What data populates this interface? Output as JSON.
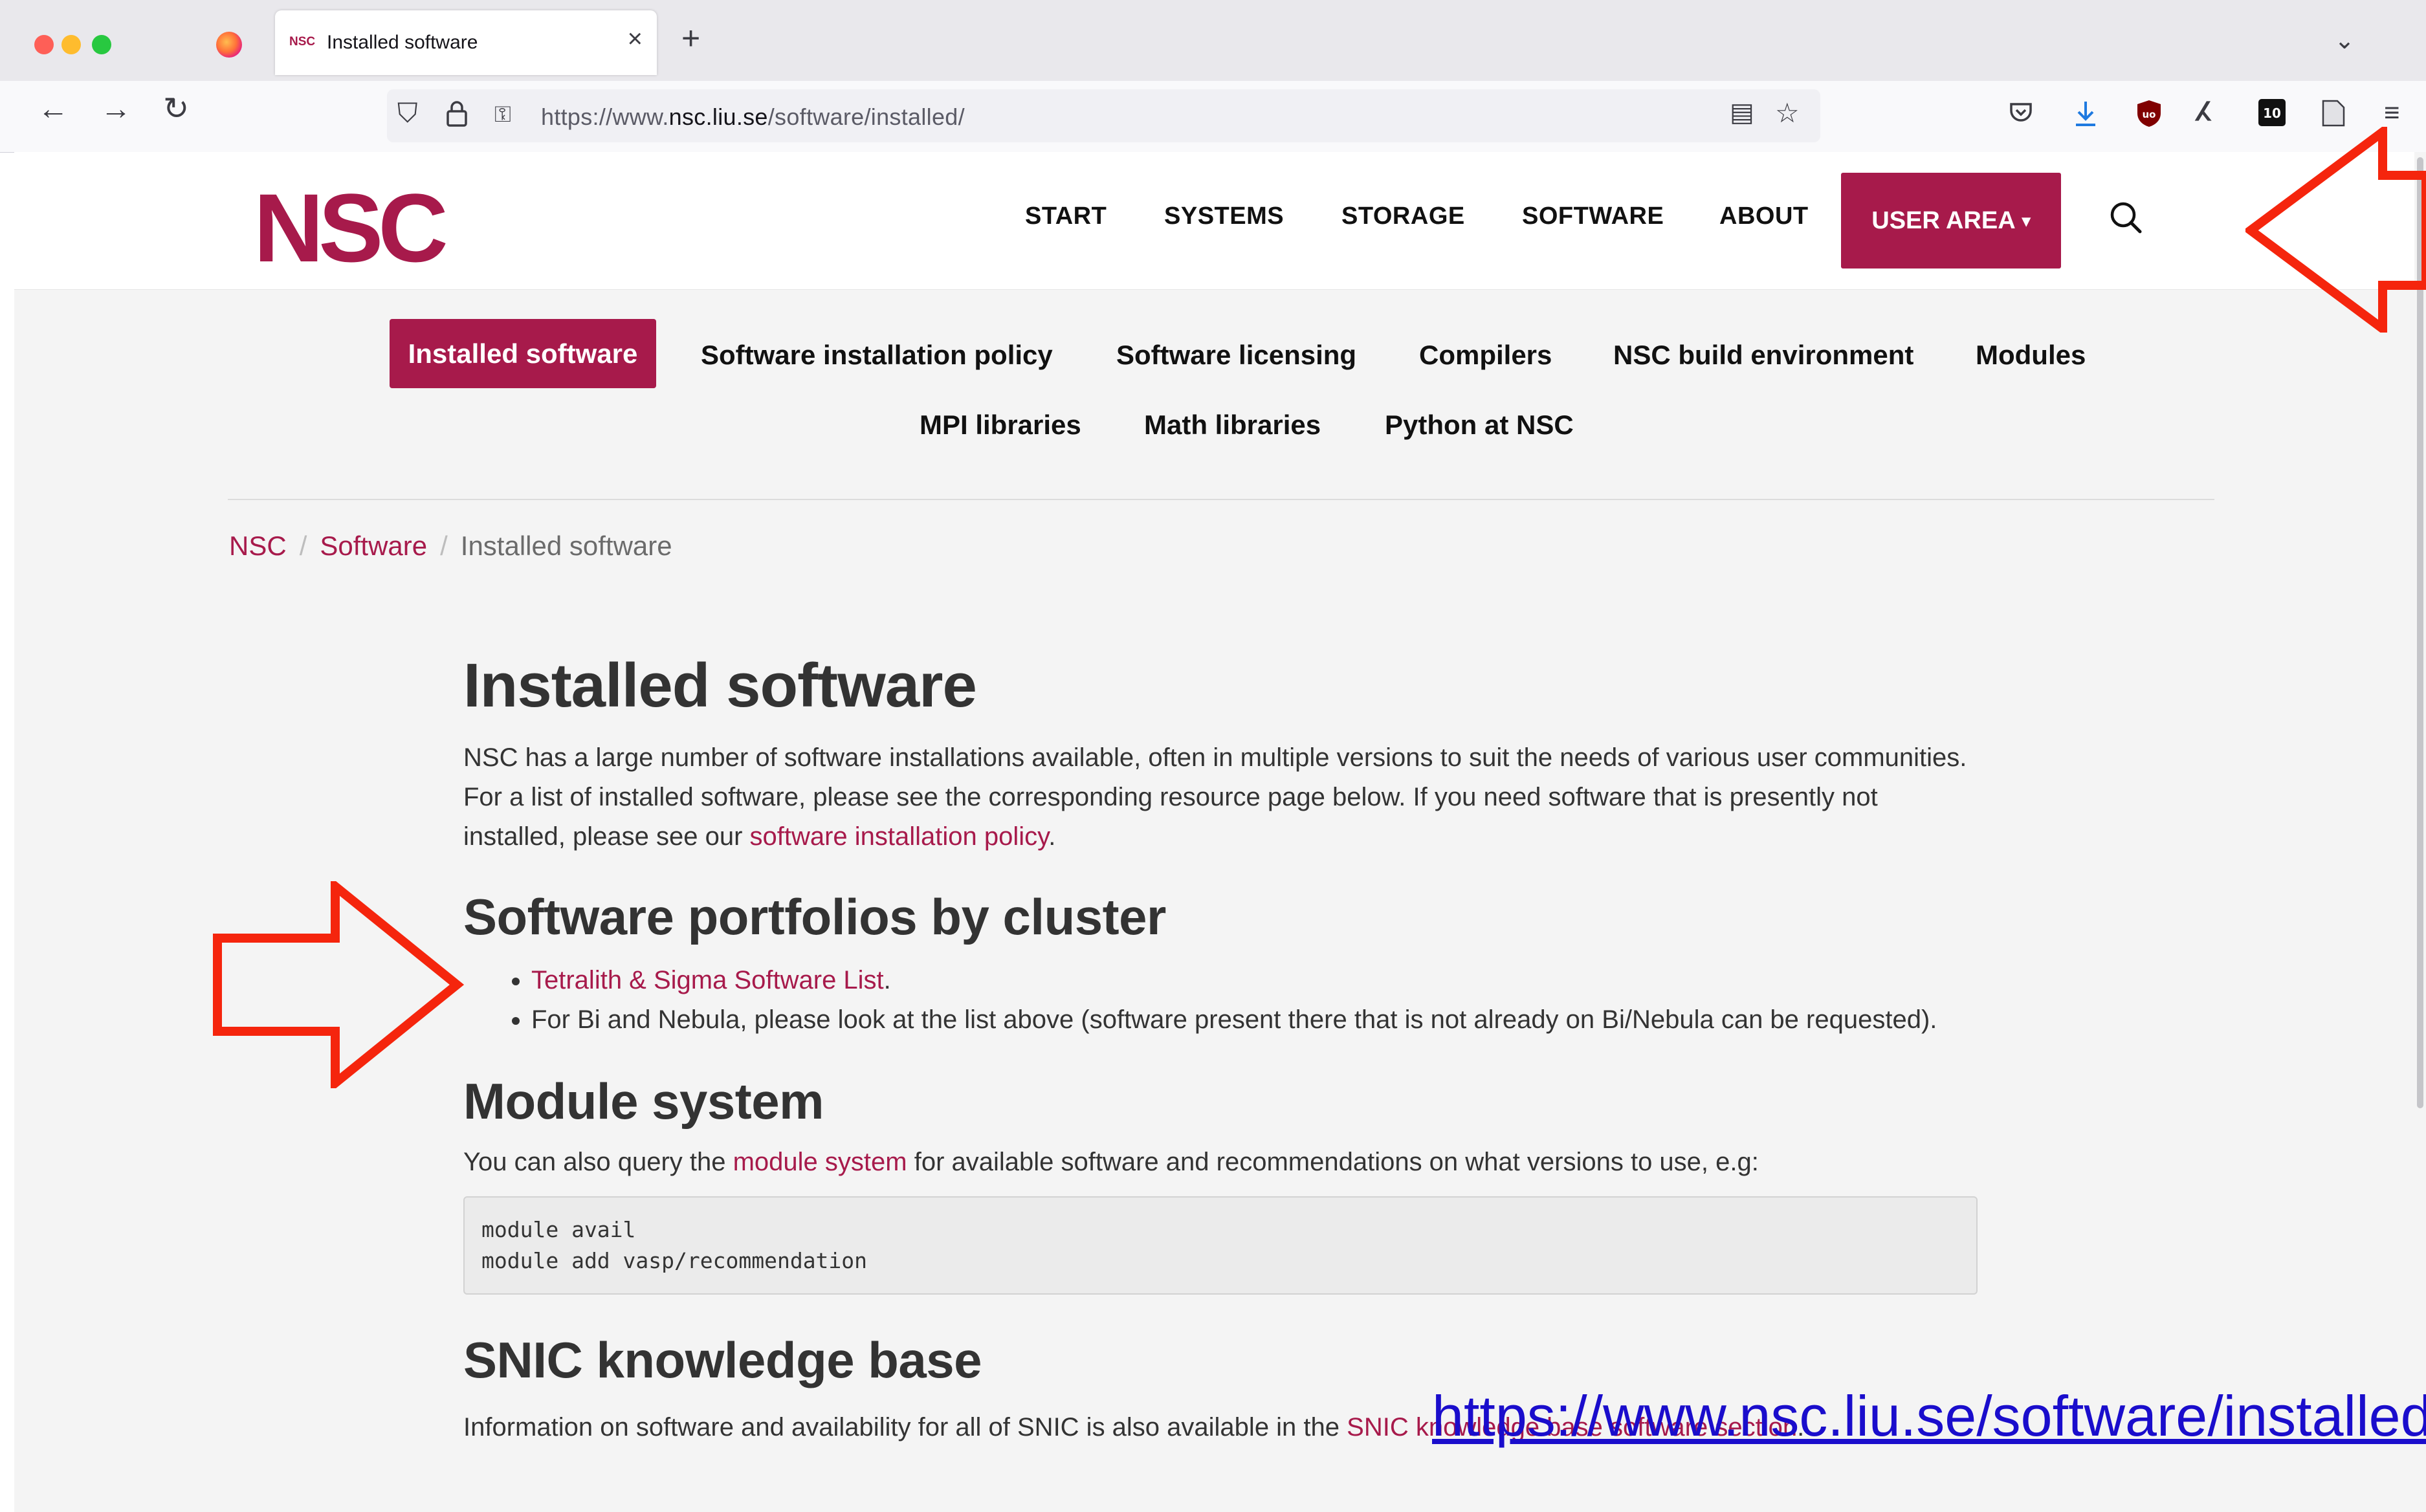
{
  "browser": {
    "tab_title": "Installed software",
    "tab_favicon_text": "NSC",
    "tab_close": "×",
    "new_tab": "+",
    "url_prefix": "https://www.",
    "url_domain": "nsc.liu.se",
    "url_path": "/software/installed/"
  },
  "header": {
    "logo_text": "NSC",
    "nav": [
      "START",
      "SYSTEMS",
      "STORAGE",
      "SOFTWARE",
      "ABOUT"
    ],
    "user_area": "USER AREA",
    "user_area_caret": "▾"
  },
  "subnav": {
    "active": "Installed software",
    "row1": [
      "Software installation policy",
      "Software licensing",
      "Compilers",
      "NSC build environment",
      "Modules"
    ],
    "row2": [
      "MPI libraries",
      "Math libraries",
      "Python at NSC"
    ]
  },
  "breadcrumb": {
    "items": [
      "NSC",
      "Software"
    ],
    "current": "Installed software",
    "separator": "/"
  },
  "content": {
    "title": "Installed software",
    "intro_before_link": "NSC has a large number of software installations available, often in multiple versions to suit the needs of various user communities. For a list of installed software, please see the corresponding resource page below. If you need software that is presently not installed, please see our ",
    "intro_link": "software installation policy",
    "intro_after_link": ".",
    "portfolios_heading": "Software portfolios by cluster",
    "portfolio_link": "Tetralith & Sigma Software List",
    "portfolio_link_after": ".",
    "portfolio_item2": "For Bi and Nebula, please look at the list above (software present there that is not already on Bi/Nebula can be requested).",
    "module_heading": "Module system",
    "module_before_link": "You can also query the ",
    "module_link": "module system",
    "module_after_link": " for available software and recommendations on what versions to use, e.g:",
    "code_lines": "module avail\nmodule add vasp/recommendation",
    "snic_heading": "SNIC knowledge base",
    "snic_before_link": "Information on software and availability for all of SNIC is also available in the ",
    "snic_link": "SNIC knowledge base software section",
    "snic_after_link": "."
  },
  "overlay": {
    "url_text": "https://www.nsc.liu.se/software/installed/"
  },
  "colors": {
    "brand": "#a71a4b",
    "annotation_arrow": "#f5250d",
    "overlay_link": "#1a0dcc"
  }
}
